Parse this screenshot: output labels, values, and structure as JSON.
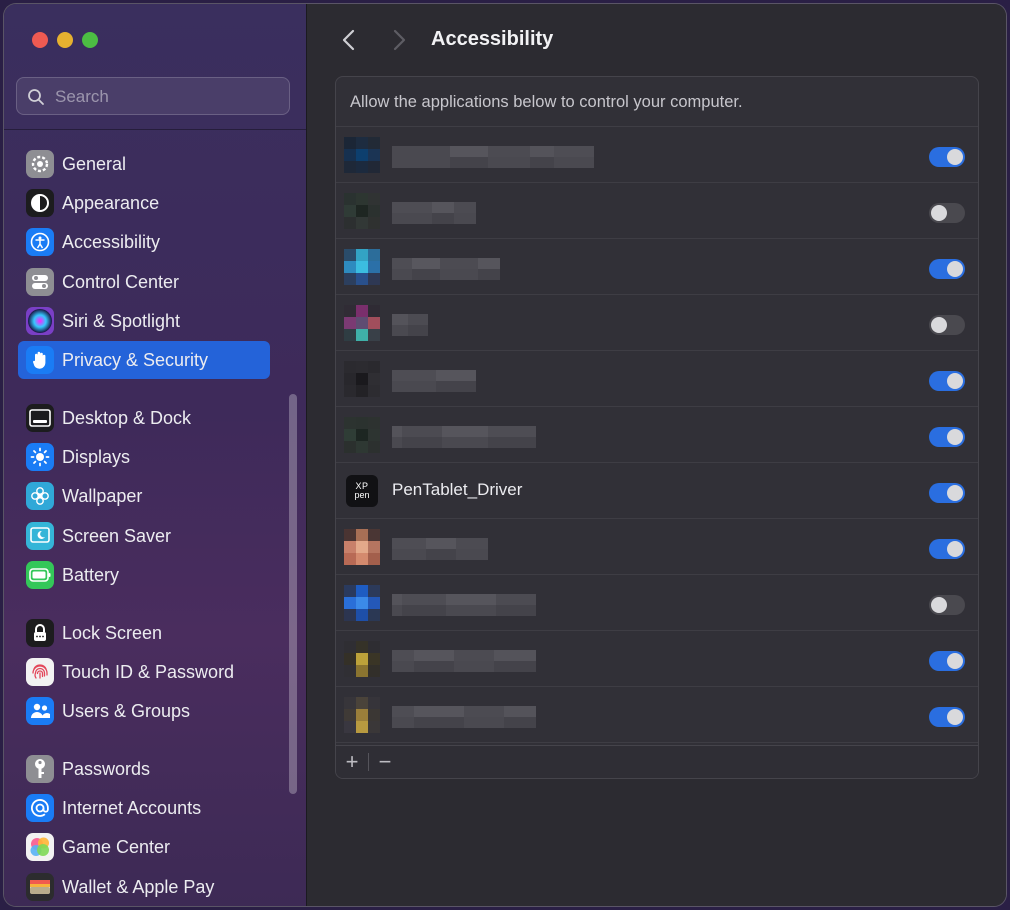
{
  "window": {
    "title": "Accessibility"
  },
  "sidebar": {
    "search_placeholder": "Search",
    "items": [
      {
        "label": "General",
        "icon": "gear-icon",
        "color": "#8e8e93"
      },
      {
        "label": "Appearance",
        "icon": "appearance-icon",
        "color": "#1c1c1e"
      },
      {
        "label": "Accessibility",
        "icon": "accessibility-icon",
        "color": "#1a7cf5"
      },
      {
        "label": "Control Center",
        "icon": "control-center-icon",
        "color": "#8e8e93"
      },
      {
        "label": "Siri & Spotlight",
        "icon": "siri-icon",
        "color": "#7a3fc6"
      },
      {
        "label": "Privacy & Security",
        "icon": "hand-icon",
        "color": "#1a7cf5",
        "active": true
      },
      {
        "label": "Desktop & Dock",
        "icon": "dock-icon",
        "color": "#1c1c1e"
      },
      {
        "label": "Displays",
        "icon": "sun-icon",
        "color": "#1a7cf5"
      },
      {
        "label": "Wallpaper",
        "icon": "flower-icon",
        "color": "#30a8d8"
      },
      {
        "label": "Screen Saver",
        "icon": "screen-saver-icon",
        "color": "#35b5d8"
      },
      {
        "label": "Battery",
        "icon": "battery-icon",
        "color": "#34c759"
      },
      {
        "label": "Lock Screen",
        "icon": "lock-icon",
        "color": "#1c1c1e"
      },
      {
        "label": "Touch ID & Password",
        "icon": "fingerprint-icon",
        "color": "#f2f2f2"
      },
      {
        "label": "Users & Groups",
        "icon": "users-icon",
        "color": "#1a7cf5"
      },
      {
        "label": "Passwords",
        "icon": "key-icon",
        "color": "#8e8e93"
      },
      {
        "label": "Internet Accounts",
        "icon": "at-icon",
        "color": "#1a7cf5"
      },
      {
        "label": "Game Center",
        "icon": "game-center-icon",
        "color": "#f2f2f2"
      },
      {
        "label": "Wallet & Apple Pay",
        "icon": "wallet-icon",
        "color": "#2c2c2e"
      }
    ]
  },
  "main": {
    "header_text": "Allow the applications below to control your computer.",
    "apps": [
      {
        "name": "",
        "enabled": true,
        "icon": [
          "#1b2636",
          "#1d2c40",
          "#222a36",
          "#16304f",
          "#0d3f6e",
          "#1b3454",
          "#1e2838",
          "#1c2a3e",
          "#212836"
        ]
      },
      {
        "name": "",
        "enabled": false,
        "icon": [
          "#2a3230",
          "#2d3631",
          "#303333",
          "#2f3b36",
          "#1e2622",
          "#2b312f",
          "#2c2f30",
          "#323836",
          "#2f3130"
        ]
      },
      {
        "name": "",
        "enabled": true,
        "icon": [
          "#2a4c6a",
          "#33a3c4",
          "#2c6d9a",
          "#2e8bbf",
          "#3bbde0",
          "#2b70a8",
          "#2c3f5e",
          "#29508c",
          "#2e3854"
        ]
      },
      {
        "name": "",
        "enabled": false,
        "icon": [
          "#302c35",
          "#7a2f6c",
          "#2f2b34",
          "#7b3a73",
          "#5f4c72",
          "#a14e5c",
          "#2f3d43",
          "#3fb0a8",
          "#394048"
        ]
      },
      {
        "name": "",
        "enabled": true,
        "icon": [
          "#2b2a2f",
          "#2c2b30",
          "#2a292e",
          "#28272c",
          "#1a191d",
          "#2f2e33",
          "#2a292e",
          "#232226",
          "#2d2c31"
        ]
      },
      {
        "name": "",
        "enabled": true,
        "icon": [
          "#2c3330",
          "#2b322f",
          "#2d3230",
          "#2f3d36",
          "#1d2622",
          "#2d3431",
          "#2b302e",
          "#2e3833",
          "#2c302f"
        ]
      },
      {
        "name": "PenTablet_Driver",
        "enabled": true,
        "icon_text": "XP\npen"
      },
      {
        "name": "",
        "enabled": true,
        "icon": [
          "#4a3432",
          "#a86f55",
          "#4a3634",
          "#c8806a",
          "#e3a98a",
          "#b57560",
          "#b86a55",
          "#d48a6e",
          "#a35f4c"
        ]
      },
      {
        "name": "",
        "enabled": false,
        "icon": [
          "#2a3a5e",
          "#1e5cc2",
          "#2c3a5a",
          "#2a6fd8",
          "#3b8ae8",
          "#2458b8",
          "#2c3550",
          "#1e4fa8",
          "#2b3854"
        ]
      },
      {
        "name": "",
        "enabled": true,
        "icon": [
          "#2f2e33",
          "#353228",
          "#2e2d32",
          "#343027",
          "#bca23a",
          "#3a3526",
          "#302f34",
          "#8a7430",
          "#322f2a"
        ]
      },
      {
        "name": "",
        "enabled": true,
        "icon": [
          "#37353a",
          "#4a433a",
          "#36343a",
          "#3f3a36",
          "#9b7f3a",
          "#3b3734",
          "#393740",
          "#b89a40",
          "#3a3738"
        ]
      }
    ]
  }
}
